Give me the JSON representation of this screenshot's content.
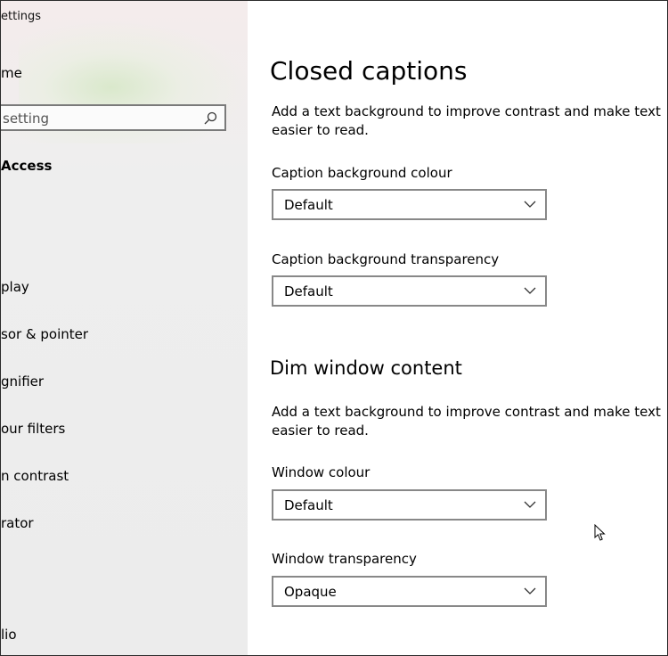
{
  "window": {
    "title": "ettings"
  },
  "sidebar": {
    "home_label": "me",
    "search": {
      "placeholder": "setting"
    },
    "section_heading": "Access",
    "items": [
      {
        "label": "play"
      },
      {
        "label": "sor & pointer"
      },
      {
        "label": "gnifier"
      },
      {
        "label": "our filters"
      },
      {
        "label": "n contrast"
      },
      {
        "label": "rator"
      },
      {
        "label": "lio"
      }
    ]
  },
  "main": {
    "title": "Closed captions",
    "closed_captions": {
      "description": "Add a text background to improve contrast and make text easier to read.",
      "background_colour": {
        "label": "Caption background colour",
        "value": "Default"
      },
      "background_transparency": {
        "label": "Caption background transparency",
        "value": "Default"
      }
    },
    "dim_window": {
      "title": "Dim window content",
      "description": "Add a text background to improve contrast and make text easier to read.",
      "window_colour": {
        "label": "Window colour",
        "value": "Default"
      },
      "window_transparency": {
        "label": "Window transparency",
        "value": "Opaque"
      }
    }
  },
  "icons": {
    "search": "search-icon",
    "dropdown": "chevron-down-icon",
    "cursor": "mouse-cursor-icon"
  },
  "colors": {
    "dropdown_border": "#888888",
    "sidebar_bg": "#ececec",
    "window_border": "#2b2b2b"
  }
}
